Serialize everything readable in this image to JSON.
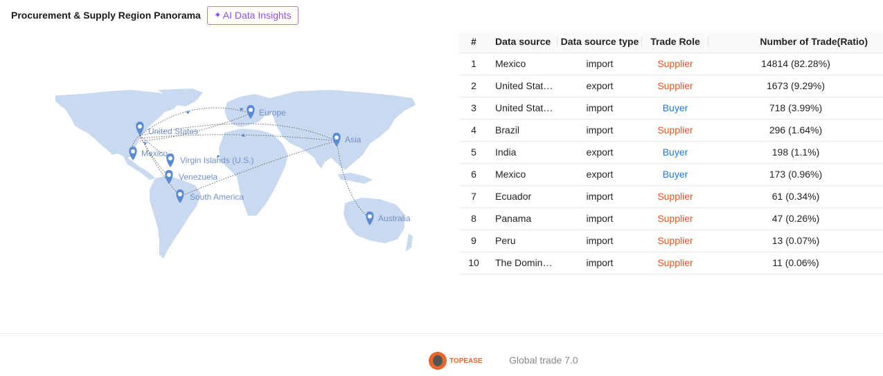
{
  "header": {
    "title": "Procurement & Supply Region Panorama",
    "ai_button_label": "AI Data Insights"
  },
  "map": {
    "pins": [
      {
        "label": "United States"
      },
      {
        "label": "Europe"
      },
      {
        "label": "Asia"
      },
      {
        "label": "Mexico"
      },
      {
        "label": "Virgin Islands (U.S.)"
      },
      {
        "label": "Venezuela"
      },
      {
        "label": "South America"
      },
      {
        "label": "Australia"
      }
    ],
    "land_color": "#c9d9ef",
    "pin_color": "#5b8bd0"
  },
  "table": {
    "headers": [
      "#",
      "Data source",
      "Data source type",
      "Trade Role",
      "Number of Trade(Ratio)"
    ],
    "rows": [
      {
        "num": "1",
        "source": "Mexico",
        "type": "import",
        "role": "Supplier",
        "count": "14814 (82.28%)"
      },
      {
        "num": "2",
        "source": "United Stat…",
        "type": "export",
        "role": "Supplier",
        "count": "1673 (9.29%)"
      },
      {
        "num": "3",
        "source": "United Stat…",
        "type": "import",
        "role": "Buyer",
        "count": "718 (3.99%)"
      },
      {
        "num": "4",
        "source": "Brazil",
        "type": "import",
        "role": "Supplier",
        "count": "296 (1.64%)"
      },
      {
        "num": "5",
        "source": "India",
        "type": "export",
        "role": "Buyer",
        "count": "198 (1.1%)"
      },
      {
        "num": "6",
        "source": "Mexico",
        "type": "export",
        "role": "Buyer",
        "count": "173 (0.96%)"
      },
      {
        "num": "7",
        "source": "Ecuador",
        "type": "import",
        "role": "Supplier",
        "count": "61 (0.34%)"
      },
      {
        "num": "8",
        "source": "Panama",
        "type": "import",
        "role": "Supplier",
        "count": "47 (0.26%)"
      },
      {
        "num": "9",
        "source": "Peru",
        "type": "import",
        "role": "Supplier",
        "count": "13 (0.07%)"
      },
      {
        "num": "10",
        "source": "The Domin…",
        "type": "import",
        "role": "Supplier",
        "count": "11 (0.06%)"
      }
    ],
    "role_colors": {
      "Supplier": "#e0531f",
      "Buyer": "#1f77cc"
    }
  },
  "footer": {
    "logo_text": "TOPEASE",
    "product": "Global trade 7.0"
  }
}
